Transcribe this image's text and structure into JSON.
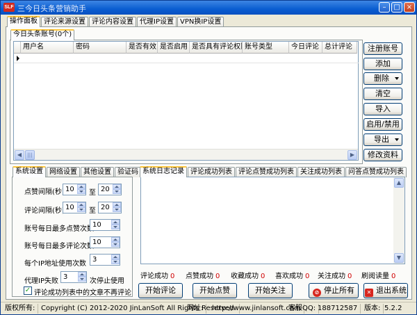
{
  "window": {
    "icon_text": "SLF",
    "title": "三今日头条营销助手",
    "controls": [
      "min",
      "max",
      "close"
    ]
  },
  "main_tabs": [
    "操作面板",
    "评论来源设置",
    "评论内容设置",
    "代理IP设置",
    "VPN换IP设置"
  ],
  "accounts": {
    "group_title": "今日头条账号(0个)",
    "columns": [
      "用户名",
      "密码",
      "是否有效",
      "是否启用",
      "是否具有评论权限",
      "账号类型",
      "今日评论",
      "总计评论"
    ]
  },
  "right_buttons": {
    "register": "注册账号",
    "add": "添加",
    "delete": "删除",
    "clear": "清空",
    "import": "导入",
    "enable": "启用/禁用",
    "export": "导出",
    "edit": "修改资料"
  },
  "settings_tabs": [
    "系统设置",
    "网络设置",
    "其他设置",
    "验证码"
  ],
  "settings": {
    "like_interval_label": "点赞间隔(秒)",
    "like_min": "10",
    "like_max": "20",
    "to": "至",
    "comment_interval_label": "评论间隔(秒)",
    "comment_min": "10",
    "comment_max": "20",
    "daily_like_label": "账号每日最多点赞次数",
    "daily_like": "10",
    "daily_comment_label": "账号每日最多评论次数",
    "daily_comment": "10",
    "ip_limit_label": "每个IP地址使用次数",
    "ip_limit": "3",
    "proxy_fail_label": "代理IP失败",
    "proxy_fail": "3",
    "proxy_fail_suffix": "次停止使用",
    "no_repeat_label": "评论成功列表中的文章不再评论"
  },
  "log_tabs": [
    "系统日志记录",
    "评论成功列表",
    "评论点赞成功列表",
    "关注成功列表",
    "问答点赞成功列表"
  ],
  "stats": {
    "comment_label": "评论成功",
    "comment_value": "0",
    "like_label": "点赞成功",
    "like_value": "0",
    "fav_label": "收藏成功",
    "fav_value": "0",
    "love_label": "喜欢成功",
    "love_value": "0",
    "follow_label": "关注成功",
    "follow_value": "0",
    "refresh_label": "刷阅读量",
    "refresh_value": "0"
  },
  "actions": {
    "start_comment": "开始评论",
    "start_like": "开始点赞",
    "start_follow": "开始关注",
    "stop_all": "停止所有",
    "exit": "退出系统"
  },
  "status_bar": {
    "copyright_label": "版权所有:",
    "copyright": "Copyright (C) 2012-2020 JinLanSoft All Rights Reserved.",
    "website_label": "网址:",
    "website": "http://www.jinlansoft.com",
    "qq_label": "客服QQ:",
    "qq": "188712587",
    "version_label": "版本:",
    "version": "5.2.2"
  }
}
